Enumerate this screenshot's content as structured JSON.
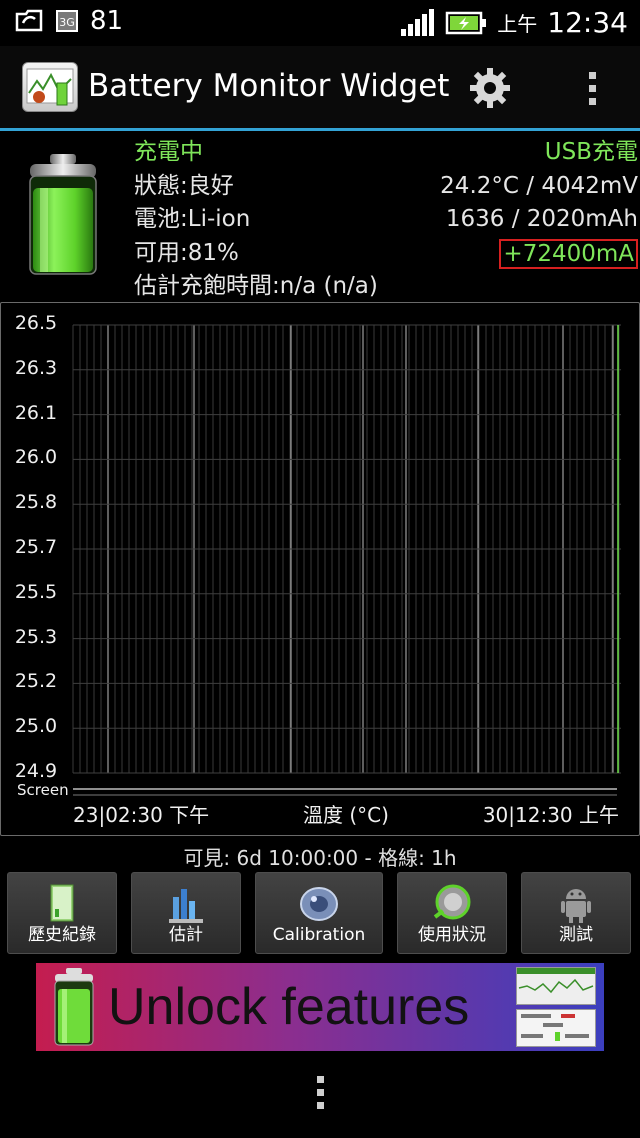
{
  "statusbar": {
    "battery_level": "81",
    "network": "3G",
    "ampm": "上午",
    "time": "12:34"
  },
  "appbar": {
    "title": "Battery Monitor Widget"
  },
  "info": {
    "charging": "充電中",
    "status": "狀態:良好",
    "battery_type": "電池:Li-ion",
    "available": "可用:81%",
    "estimate": "估計充飽時間:n/a (n/a)",
    "source": "USB充電",
    "temp_voltage": "24.2°C / 4042mV",
    "capacity": "1636 / 2020mAh",
    "current": "+72400mA"
  },
  "graph": {
    "y_ticks": [
      "26.5",
      "26.3",
      "26.1",
      "26.0",
      "25.8",
      "25.7",
      "25.5",
      "25.3",
      "25.2",
      "25.0",
      "24.9"
    ],
    "screen_label": "Screen",
    "x_start": "23|02:30 下午",
    "x_title": "溫度 (°C)",
    "x_end": "30|12:30 上午"
  },
  "visible_summary": "可見: 6d 10:00:00 - 格線: 1h",
  "buttons": [
    {
      "label": "歷史紀錄",
      "icon": "history-icon"
    },
    {
      "label": "估計",
      "icon": "estimate-icon"
    },
    {
      "label": "Calibration",
      "icon": "calibration-icon"
    },
    {
      "label": "使用狀況",
      "icon": "usage-icon"
    },
    {
      "label": "測試",
      "icon": "android-icon"
    }
  ],
  "banner": {
    "text": "Unlock features"
  },
  "colors": {
    "accent": "#33a3d5",
    "green_text": "#7fe65a",
    "highlight_border": "#d62020"
  }
}
